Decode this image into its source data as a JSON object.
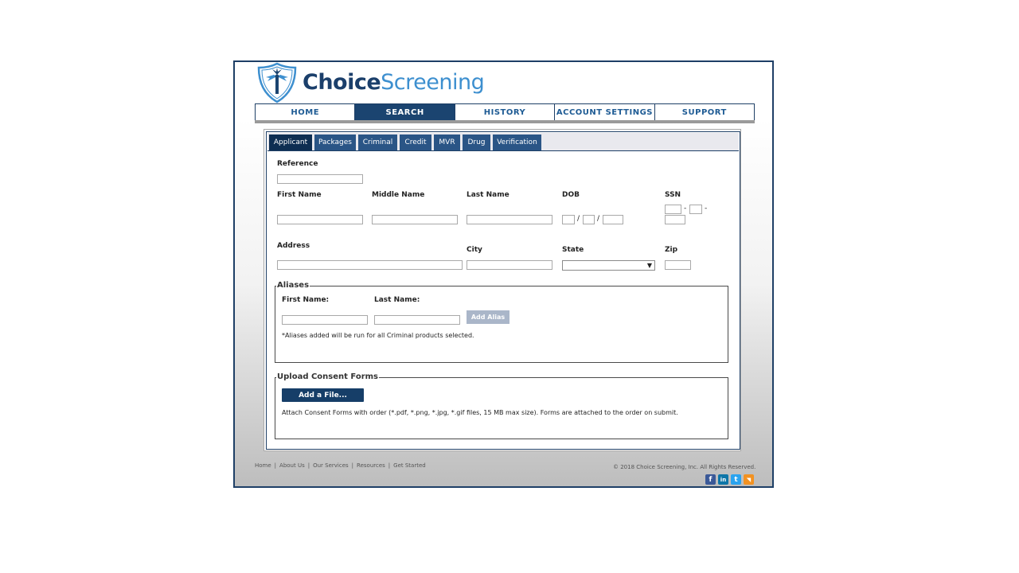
{
  "brand": {
    "name_bold": "Choice",
    "name_light": "Screening"
  },
  "nav": {
    "items": [
      {
        "label": "HOME"
      },
      {
        "label": "SEARCH"
      },
      {
        "label": "HISTORY"
      },
      {
        "label": "ACCOUNT SETTINGS"
      },
      {
        "label": "SUPPORT"
      }
    ],
    "active": "SEARCH"
  },
  "tabs": [
    {
      "label": "Applicant"
    },
    {
      "label": "Packages"
    },
    {
      "label": "Criminal"
    },
    {
      "label": "Credit"
    },
    {
      "label": "MVR"
    },
    {
      "label": "Drug"
    },
    {
      "label": "Verification"
    }
  ],
  "form": {
    "reference_label": "Reference",
    "first_name_label": "First Name",
    "middle_name_label": "Middle Name",
    "last_name_label": "Last Name",
    "dob_label": "DOB",
    "ssn_label": "SSN",
    "address_label": "Address",
    "city_label": "City",
    "state_label": "State",
    "zip_label": "Zip",
    "dob_sep": "/",
    "ssn_sep": "-",
    "state_arrow": "▼"
  },
  "aliases": {
    "legend": "Aliases",
    "first_name_label": "First Name:",
    "last_name_label": "Last Name:",
    "add_button": "Add Alias",
    "note": "*Aliases added will be run for all Criminal products selected."
  },
  "consent": {
    "legend": "Upload Consent Forms",
    "add_file_button": "Add a File...",
    "note": "Attach Consent Forms with order (*.pdf, *.png, *.jpg, *.gif files, 15 MB max size). Forms are attached to the order on submit."
  },
  "footer": {
    "links": [
      "Home",
      "About Us",
      "Our Services",
      "Resources",
      "Get Started"
    ],
    "separator": "|",
    "copyright": "© 2018 Choice Screening, Inc. All Rights Reserved."
  },
  "social": [
    {
      "icon": "facebook-icon",
      "glyph": "f",
      "color": "#3b5998"
    },
    {
      "icon": "linkedin-icon",
      "glyph": "in",
      "color": "#0e76a8"
    },
    {
      "icon": "twitter-icon",
      "glyph": "t",
      "color": "#2aa3ef"
    },
    {
      "icon": "rss-icon",
      "glyph": "◥",
      "color": "#f29222"
    }
  ],
  "colors": {
    "primary": "#1b4470",
    "accent": "#3d8fcf",
    "nav_text": "#1e5b94"
  }
}
